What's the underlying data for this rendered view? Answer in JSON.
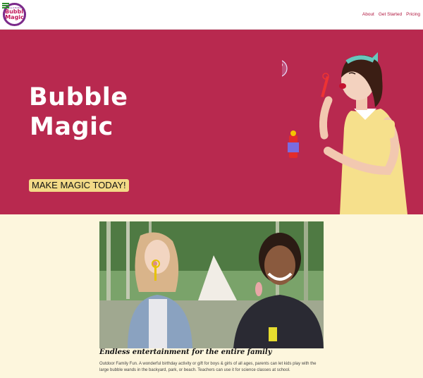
{
  "header": {
    "logo": {
      "tiny": "Soap & Bubble",
      "line1": "Bubble",
      "line2": "Magic"
    },
    "nav": [
      "About",
      "Get Started",
      "Pricing"
    ]
  },
  "hero": {
    "title_line1": "Bubble",
    "title_line2": "Magic",
    "tagline": "MAKE MAGIC TODAY!"
  },
  "feature": {
    "title": "Endless entertainment for the entire family",
    "body": "Outdoor Family Fun. A wonderful birthday activity or gift for boys & girls of all ages, parents can let kids play with the large bubble wands in the backyard, park, or beach. Teachers can use it for science classes at school."
  },
  "colors": {
    "hero_bg": "#b8294f",
    "accent": "#b0173f",
    "tagline_bg": "#f3da87",
    "content_bg": "#fdf6dd"
  }
}
